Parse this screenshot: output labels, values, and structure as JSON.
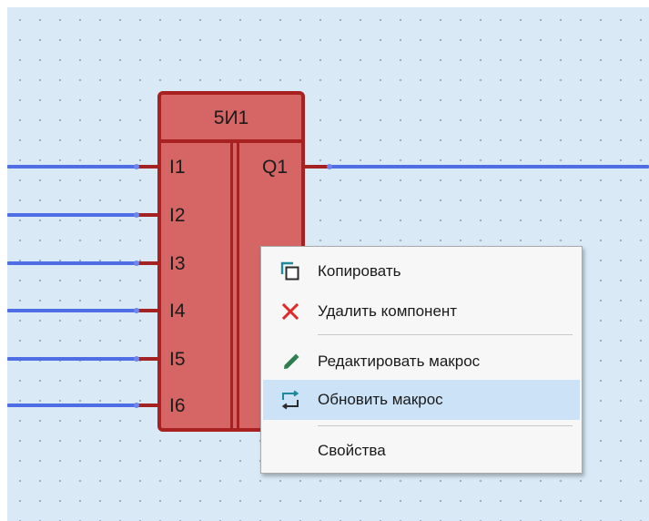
{
  "component": {
    "title": "5И1",
    "inputs": [
      "I1",
      "I2",
      "I3",
      "I4",
      "I5",
      "I6"
    ],
    "output": "Q1"
  },
  "context_menu": {
    "items": [
      {
        "label": "Копировать",
        "icon": "copy-icon"
      },
      {
        "label": "Удалить компонент",
        "icon": "close-icon"
      },
      {
        "label": "Редактировать макрос",
        "icon": "pencil-icon"
      },
      {
        "label": "Обновить макрос",
        "icon": "refresh-icon",
        "highlighted": true
      },
      {
        "label": "Свойства",
        "icon": ""
      }
    ]
  },
  "colors": {
    "canvas": "#d9e9f6",
    "wire": "#4f6ee6",
    "block_fill": "#d66565",
    "block_border": "#a82020",
    "menu_highlight": "#cce2f7"
  }
}
